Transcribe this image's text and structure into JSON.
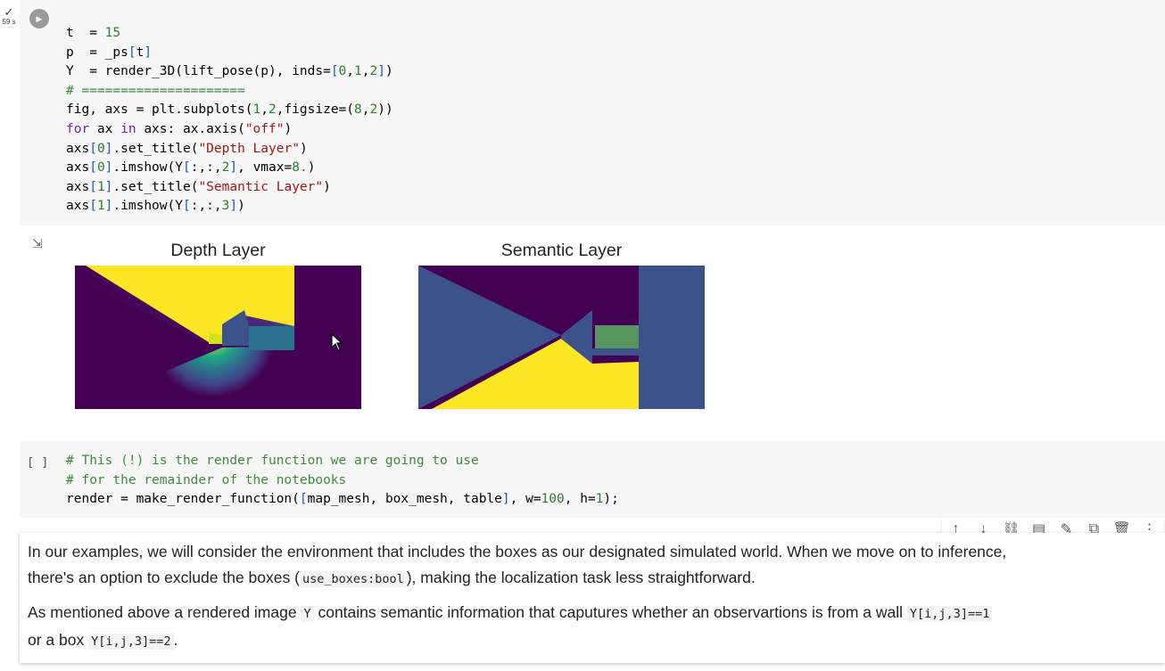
{
  "cell1": {
    "status_check": "✓",
    "status_time": "59 s",
    "code_lines": [
      [
        {
          "t": "t  = ",
          "c": ""
        },
        {
          "t": "15",
          "c": "num"
        }
      ],
      [
        {
          "t": "p  = _ps",
          "c": ""
        },
        {
          "t": "[",
          "c": "br"
        },
        {
          "t": "t",
          "c": ""
        },
        {
          "t": "]",
          "c": "br"
        }
      ],
      [
        {
          "t": "Y  = render_3D(lift_pose(p), inds=",
          "c": ""
        },
        {
          "t": "[",
          "c": "br"
        },
        {
          "t": "0",
          "c": "num"
        },
        {
          "t": ",",
          "c": ""
        },
        {
          "t": "1",
          "c": "num"
        },
        {
          "t": ",",
          "c": ""
        },
        {
          "t": "2",
          "c": "num"
        },
        {
          "t": "]",
          "c": "br"
        },
        {
          "t": ")",
          "c": ""
        }
      ],
      [
        {
          "t": "# =====================",
          "c": "cm"
        }
      ],
      [
        {
          "t": "fig, axs = plt.subplots(",
          "c": ""
        },
        {
          "t": "1",
          "c": "num"
        },
        {
          "t": ",",
          "c": ""
        },
        {
          "t": "2",
          "c": "num"
        },
        {
          "t": ",figsize=(",
          "c": ""
        },
        {
          "t": "8",
          "c": "num"
        },
        {
          "t": ",",
          "c": ""
        },
        {
          "t": "2",
          "c": "num"
        },
        {
          "t": "))",
          "c": ""
        }
      ],
      [
        {
          "t": "for",
          "c": "kw"
        },
        {
          "t": " ax ",
          "c": ""
        },
        {
          "t": "in",
          "c": "kw"
        },
        {
          "t": " axs: ax.axis(",
          "c": ""
        },
        {
          "t": "\"off\"",
          "c": "str"
        },
        {
          "t": ")",
          "c": ""
        }
      ],
      [
        {
          "t": "axs",
          "c": ""
        },
        {
          "t": "[",
          "c": "br"
        },
        {
          "t": "0",
          "c": "num"
        },
        {
          "t": "]",
          "c": "br"
        },
        {
          "t": ".set_title(",
          "c": ""
        },
        {
          "t": "\"Depth Layer\"",
          "c": "str"
        },
        {
          "t": ")",
          "c": ""
        }
      ],
      [
        {
          "t": "axs",
          "c": ""
        },
        {
          "t": "[",
          "c": "br"
        },
        {
          "t": "0",
          "c": "num"
        },
        {
          "t": "]",
          "c": "br"
        },
        {
          "t": ".imshow(Y",
          "c": ""
        },
        {
          "t": "[",
          "c": "br"
        },
        {
          "t": ":,:,",
          "c": ""
        },
        {
          "t": "2",
          "c": "num"
        },
        {
          "t": "]",
          "c": "br"
        },
        {
          "t": ", vmax=",
          "c": ""
        },
        {
          "t": "8.",
          "c": "num"
        },
        {
          "t": ")",
          "c": ""
        }
      ],
      [
        {
          "t": "axs",
          "c": ""
        },
        {
          "t": "[",
          "c": "br"
        },
        {
          "t": "1",
          "c": "num"
        },
        {
          "t": "]",
          "c": "br"
        },
        {
          "t": ".set_title(",
          "c": ""
        },
        {
          "t": "\"Semantic Layer\"",
          "c": "str"
        },
        {
          "t": ")",
          "c": ""
        }
      ],
      [
        {
          "t": "axs",
          "c": ""
        },
        {
          "t": "[",
          "c": "br"
        },
        {
          "t": "1",
          "c": "num"
        },
        {
          "t": "]",
          "c": "br"
        },
        {
          "t": ".imshow(Y",
          "c": ""
        },
        {
          "t": "[",
          "c": "br"
        },
        {
          "t": ":,:,",
          "c": ""
        },
        {
          "t": "3",
          "c": "num"
        },
        {
          "t": "]",
          "c": "br"
        },
        {
          "t": ")",
          "c": ""
        }
      ]
    ]
  },
  "output": {
    "plot1_title": "Depth Layer",
    "plot2_title": "Semantic Layer"
  },
  "cell2": {
    "bracket": "[ ]",
    "code_lines": [
      [
        {
          "t": "# This (!) is the render function we are going to use",
          "c": "cm"
        }
      ],
      [
        {
          "t": "# for the remainder of the notebooks",
          "c": "cm"
        }
      ],
      [
        {
          "t": "render = make_render_function(",
          "c": ""
        },
        {
          "t": "[",
          "c": "br"
        },
        {
          "t": "map_mesh, box_mesh, table",
          "c": ""
        },
        {
          "t": "]",
          "c": "br"
        },
        {
          "t": ", w=",
          "c": ""
        },
        {
          "t": "100",
          "c": "num"
        },
        {
          "t": ", h=",
          "c": ""
        },
        {
          "t": "1",
          "c": "num"
        },
        {
          "t": ");",
          "c": ""
        }
      ]
    ]
  },
  "toolbar": {
    "icons": [
      "arrow-up-icon",
      "arrow-down-icon",
      "link-icon",
      "comment-icon",
      "edit-icon",
      "mirror-cell-icon",
      "delete-icon",
      "more-icon"
    ]
  },
  "textcell": {
    "p1_a": "In our examples, we will consider the environment that includes the boxes as our designated simulated world. When we move on to inference,",
    "p1_b": "there's an option to exclude the boxes (",
    "p1_code": "use_boxes:bool",
    "p1_c": "), making the localization task less straightforward.",
    "p2_a": "As mentioned above a rendered image ",
    "p2_code1": "Y",
    "p2_b": " contains semantic information that caputures whether an observartions is from a wall ",
    "p2_code2": "Y[i,j,3]==1",
    "p2_c": "or a box ",
    "p2_code3": "Y[i,j,3]==2",
    "p2_d": "."
  },
  "colors": {
    "viridis_dark": "#440154",
    "viridis_blue": "#3b528b",
    "viridis_teal": "#21918c",
    "viridis_green": "#5ec962",
    "viridis_yellow": "#fde725"
  }
}
